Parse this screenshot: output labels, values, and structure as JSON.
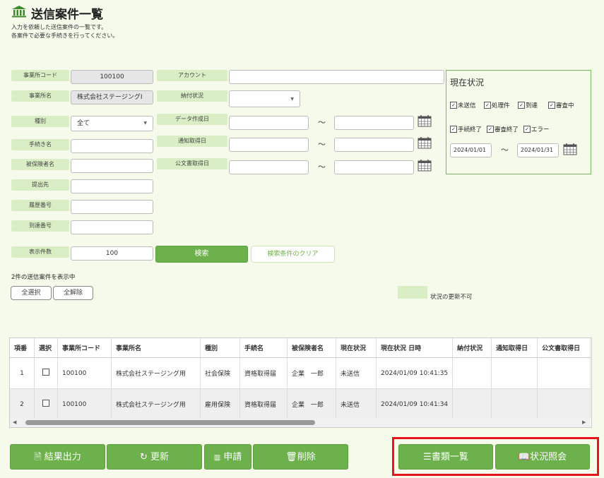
{
  "header": {
    "title": "送信案件一覧",
    "desc1": "入力を依頼した送信案件の一覧です。",
    "desc2": "各案件で必要な手続きを行ってください。"
  },
  "form": {
    "office_code_label": "事業所コード",
    "office_code_value": "100100",
    "office_name_label": "事業所名",
    "office_name_value": "株式会社ステージングⅠ",
    "type_label": "種別",
    "type_value": "全て",
    "procedure_label": "手続き名",
    "insured_label": "被保険者名",
    "submit_to_label": "提出先",
    "history_label": "履歴番号",
    "arrival_label": "到達番号",
    "display_count_label": "表示件数",
    "display_count_value": "100",
    "account_label": "アカウント",
    "payment_label": "納付状況",
    "created_label": "データ作成日",
    "notice_label": "通知取得日",
    "public_doc_label": "公文書取得日",
    "tilde": "～",
    "search_button": "検索",
    "clear_button": "検索条件のクリア"
  },
  "status_panel": {
    "title": "現在状況",
    "checks": [
      "未送信",
      "処理件",
      "到達",
      "審査中",
      "手続終了",
      "審査終了",
      "エラー"
    ],
    "date_from": "2024/01/01",
    "date_to": "2024/01/31",
    "tilde": "～"
  },
  "results": {
    "count_text": "2件の送信案件を表示中",
    "select_all": "全選択",
    "deselect_all": "全解除",
    "legend_text": "状況の更新不可",
    "legend_color": "#d9eec4"
  },
  "table": {
    "headers": [
      "項番",
      "選択",
      "事業所コード",
      "事業所名",
      "種別",
      "手続名",
      "被保険者名",
      "現在状況",
      "現在状況 日時",
      "納付状況",
      "通知取得日",
      "公文書取得日"
    ],
    "rows": [
      [
        "1",
        "",
        "100100",
        "株式会社ステージング用",
        "社会保険",
        "資格取得届",
        "企業　一郎",
        "未送信",
        "2024/01/09 10:41:35",
        "",
        "",
        ""
      ],
      [
        "2",
        "",
        "100100",
        "株式会社ステージング用",
        "雇用保険",
        "資格取得届",
        "企業　一郎",
        "未送信",
        "2024/01/09 10:41:34",
        "",
        "",
        ""
      ]
    ]
  },
  "buttons": {
    "result_output": "結果出力",
    "refresh": "更新",
    "apply": "申請",
    "delete": "削除",
    "doc_list": "書類一覧",
    "status_inquiry": "状況照会"
  },
  "colors": {
    "accent": "#6cb14b",
    "label_bg": "#d9eec4",
    "highlight_border": "#e8141d"
  }
}
